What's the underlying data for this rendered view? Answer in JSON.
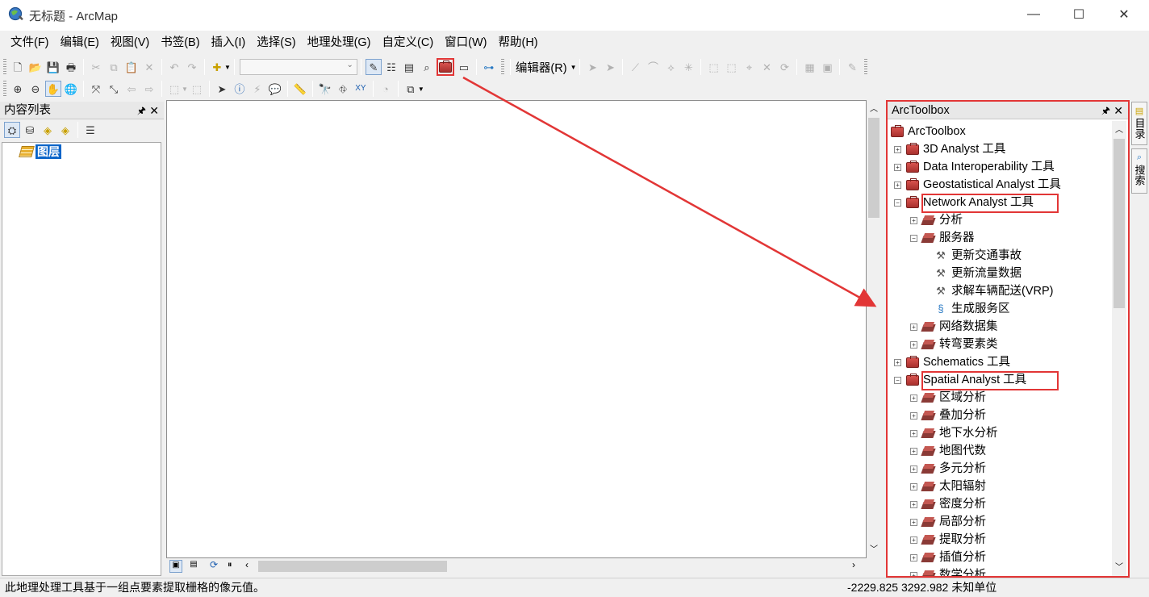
{
  "window": {
    "title": "无标题 - ArcMap",
    "minimize_glyph": "—",
    "maximize_glyph": "☐",
    "close_glyph": "✕"
  },
  "menu": [
    "文件(F)",
    "编辑(E)",
    "视图(V)",
    "书签(B)",
    "插入(I)",
    "选择(S)",
    "地理处理(G)",
    "自定义(C)",
    "窗口(W)",
    "帮助(H)"
  ],
  "toolbar": {
    "editor_label": "编辑器(R)"
  },
  "toc": {
    "title": "内容列表",
    "layer_label": "图层"
  },
  "arctoolbox": {
    "title": "ArcToolbox",
    "root": "ArcToolbox",
    "items": [
      {
        "label": "3D Analyst 工具",
        "level": 0,
        "kind": "toolbox",
        "expander": "+"
      },
      {
        "label": "Data Interoperability 工具",
        "level": 0,
        "kind": "toolbox",
        "expander": "+"
      },
      {
        "label": "Geostatistical Analyst 工具",
        "level": 0,
        "kind": "toolbox",
        "expander": "+"
      },
      {
        "label": "Network Analyst 工具",
        "level": 0,
        "kind": "toolbox",
        "expander": "−",
        "highlighted": true
      },
      {
        "label": "分析",
        "level": 1,
        "kind": "toolset",
        "expander": "+"
      },
      {
        "label": "服务器",
        "level": 1,
        "kind": "toolset",
        "expander": "−"
      },
      {
        "label": "更新交通事故",
        "level": 2,
        "kind": "tool"
      },
      {
        "label": "更新流量数据",
        "level": 2,
        "kind": "tool"
      },
      {
        "label": "求解车辆配送(VRP)",
        "level": 2,
        "kind": "tool"
      },
      {
        "label": "生成服务区",
        "level": 2,
        "kind": "script"
      },
      {
        "label": "网络数据集",
        "level": 1,
        "kind": "toolset",
        "expander": "+"
      },
      {
        "label": "转弯要素类",
        "level": 1,
        "kind": "toolset",
        "expander": "+"
      },
      {
        "label": "Schematics 工具",
        "level": 0,
        "kind": "toolbox",
        "expander": "+"
      },
      {
        "label": "Spatial Analyst 工具",
        "level": 0,
        "kind": "toolbox",
        "expander": "−",
        "highlighted": true
      },
      {
        "label": "区域分析",
        "level": 1,
        "kind": "toolset",
        "expander": "+"
      },
      {
        "label": "叠加分析",
        "level": 1,
        "kind": "toolset",
        "expander": "+"
      },
      {
        "label": "地下水分析",
        "level": 1,
        "kind": "toolset",
        "expander": "+"
      },
      {
        "label": "地图代数",
        "level": 1,
        "kind": "toolset",
        "expander": "+"
      },
      {
        "label": "多元分析",
        "level": 1,
        "kind": "toolset",
        "expander": "+"
      },
      {
        "label": "太阳辐射",
        "level": 1,
        "kind": "toolset",
        "expander": "+"
      },
      {
        "label": "密度分析",
        "level": 1,
        "kind": "toolset",
        "expander": "+"
      },
      {
        "label": "局部分析",
        "level": 1,
        "kind": "toolset",
        "expander": "+"
      },
      {
        "label": "提取分析",
        "level": 1,
        "kind": "toolset",
        "expander": "+"
      },
      {
        "label": "插值分析",
        "level": 1,
        "kind": "toolset",
        "expander": "+"
      },
      {
        "label": "数学分析",
        "level": 1,
        "kind": "toolset",
        "expander": "+"
      }
    ]
  },
  "side_tabs": {
    "catalog": "目录",
    "search": "搜索"
  },
  "status": {
    "message": "此地理处理工具基于一组点要素提取栅格的像元值。",
    "coordinates": "-2229.825  3292.982 未知单位"
  },
  "colors": {
    "highlight": "#e23636",
    "selected_layer_bg": "#0a64c8"
  }
}
